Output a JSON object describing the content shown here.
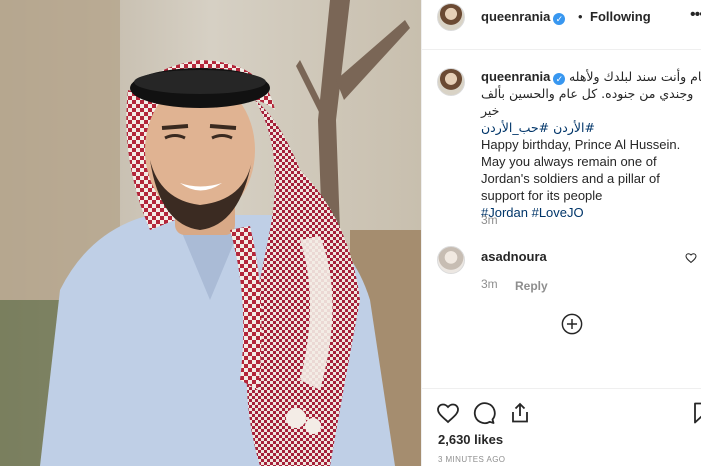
{
  "post": {
    "image_alt": "Photo of a smiling young man wearing a red and white shemagh and a light blue shirt",
    "colors": {
      "shemagh_red": "#b3263a",
      "shirt": "#bfcfe6",
      "link_blue": "#003569",
      "verified": "#3897f0"
    }
  },
  "header": {
    "username": "queenrania",
    "separator": "•",
    "follow_status": "Following",
    "more_icon": "ellipsis-icon",
    "more_label": "•••"
  },
  "caption": {
    "username": "queenrania",
    "arabic_line1": "كل عام وأنت سند لبلدك ولأهله",
    "arabic_line2": "وجندي من جنوده. كل عام والحسين بألف خير",
    "arabic_hashtag": "#الأردن #حب_الأردن",
    "english": "Happy birthday, Prince Al Hussein. May you always remain one of Jordan's soldiers and a pillar of support for its people",
    "hashtags": "#Jordan #LoveJO",
    "time": "3m"
  },
  "comment": {
    "username": "asadnoura",
    "time": "3m",
    "reply_label": "Reply"
  },
  "actions": {
    "like_icon": "heart-icon",
    "comment_icon": "comment-icon",
    "share_icon": "share-icon",
    "save_icon": "bookmark-icon",
    "likes": "2,630 likes",
    "posted_ago": "3 MINUTES AGO"
  }
}
